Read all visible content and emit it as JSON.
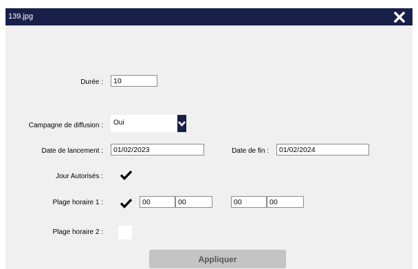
{
  "window": {
    "title": "139.jpg",
    "close_icon": "close-icon"
  },
  "form": {
    "duree": {
      "label": "Durée :",
      "value": "10"
    },
    "campagne": {
      "label": "Campagne de diffusion :",
      "value": "Oui"
    },
    "date_lancement": {
      "label": "Date de lancement :",
      "value": "01/02/2023"
    },
    "date_fin": {
      "label": "Date de fin :",
      "value": "01/02/2024"
    },
    "jour_autorises": {
      "label": "Jour Autorisés :",
      "checked": true
    },
    "plage1": {
      "label": "Plage horaire 1 :",
      "checked": true,
      "start_h": "00",
      "start_m": "00",
      "end_h": "00",
      "end_m": "00"
    },
    "plage2": {
      "label": "Plage horaire 2 :",
      "checked": false
    },
    "apply_label": "Appliquer"
  },
  "colors": {
    "titlebar": "#18204a",
    "panel": "#f0f0f0",
    "button": "#c4c4c4"
  }
}
